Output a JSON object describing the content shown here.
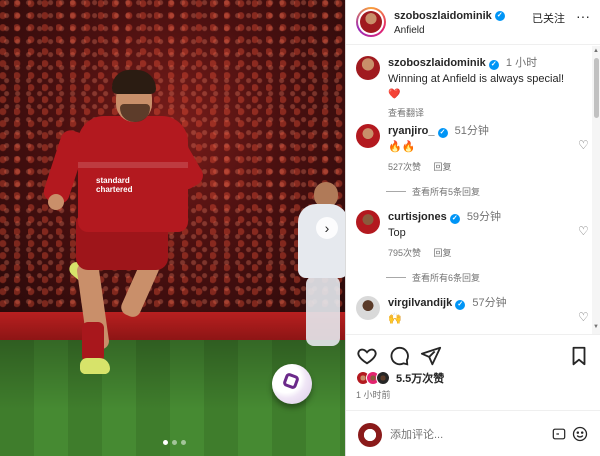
{
  "post": {
    "username": "szoboszlaidominik",
    "location": "Anfield",
    "follow_label": "已关注",
    "more_label": "···"
  },
  "photo": {
    "sponsor_text": "standard chartered",
    "carousel": {
      "total": 3,
      "active": 1
    },
    "next_label": "›"
  },
  "caption": {
    "username": "szoboszlaidominik",
    "time": "1 小时",
    "text": "Winning at Anfield is always special!",
    "emoji": "❤️",
    "translate_label": "查看翻译"
  },
  "comments": [
    {
      "username": "ryanjiro_",
      "time": "51分钟",
      "text": "🔥🔥",
      "likes": "527次赞",
      "reply_label": "回复",
      "view_replies": "查看所有5条回复"
    },
    {
      "username": "curtisjones",
      "time": "59分钟",
      "text": "Top",
      "likes": "795次赞",
      "reply_label": "回复",
      "view_replies": "查看所有6条回复"
    },
    {
      "username": "virgilvandijk",
      "time": "57分钟",
      "text": "🙌",
      "likes": "",
      "reply_label": "",
      "view_replies": ""
    }
  ],
  "likes": {
    "count": "5.5万次赞",
    "posted": "1 小时前"
  },
  "composer": {
    "placeholder": "添加评论..."
  },
  "icons": {
    "like": "heart-icon",
    "comment": "comment-icon",
    "share": "send-icon",
    "save": "bookmark-icon",
    "emoji": "emoji-icon",
    "gif": "gif-icon",
    "verified": "verified-badge-icon",
    "scroll_up": "▲",
    "scroll_down": "▼"
  },
  "colors": {
    "verified_blue": "#0095f6",
    "liverpool_red": "#b3191f",
    "pitch_green": "#3f7d2c",
    "muted_text": "#737373"
  }
}
